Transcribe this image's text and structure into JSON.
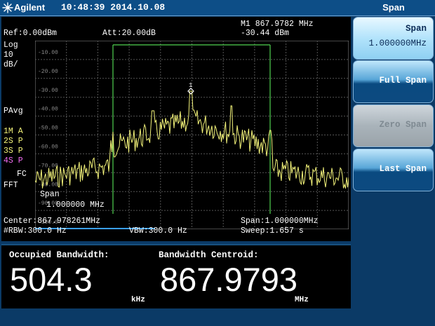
{
  "header": {
    "brand": "Agilent",
    "clock": "10:48:39 2014.10.08",
    "menu_title": "Span"
  },
  "screen": {
    "ref": "Ref:0.00dBm",
    "att": "Att:20.00dB",
    "marker_freq": "M1 867.9782 MHz",
    "marker_level": "-30.44 dBm",
    "scale_type": "Log",
    "scale_value": "10",
    "scale_unit": "dB/",
    "avg": "PAvg",
    "traces": [
      "1M A",
      "2S P",
      "3S P",
      "4S P"
    ],
    "fc": "FC",
    "fft": "FFT",
    "marker_label": "1",
    "y_ticks": [
      "-10.00",
      "-20.00",
      "-30.00",
      "-40.00",
      "-50.00",
      "-60.00",
      "-70.00",
      "-80.00",
      "-90.00",
      "-100.0"
    ],
    "span_overlay_label": "Span",
    "span_overlay_value": "1.000000 MHz",
    "center": "Center:867.978261MHz",
    "span": "Span:1.000000MHz",
    "rbw": "#RBW:300.0 Hz",
    "vbw": "VBW:300.0 Hz",
    "sweep": "Sweep:1.657 s"
  },
  "results": {
    "obw_label": "Occupied Bandwidth:",
    "obw_value": "504.3",
    "obw_unit": "kHz",
    "centroid_label": "Bandwidth Centroid:",
    "centroid_value": "867.9793",
    "centroid_unit": "MHz"
  },
  "softkeys": [
    {
      "label": "Span",
      "value": "1.000000MHz"
    },
    {
      "label": "Full Span"
    },
    {
      "label": "Zero Span"
    },
    {
      "label": "Last Span"
    }
  ],
  "colors": {
    "trace": "#f3f37a",
    "obw_lines": "#4fd24f",
    "grid": "#5a5a5a",
    "trace4": "#f06cf0"
  },
  "icons": {
    "logo": "agilent-spark-icon",
    "marker": "diamond-marker-icon"
  }
}
